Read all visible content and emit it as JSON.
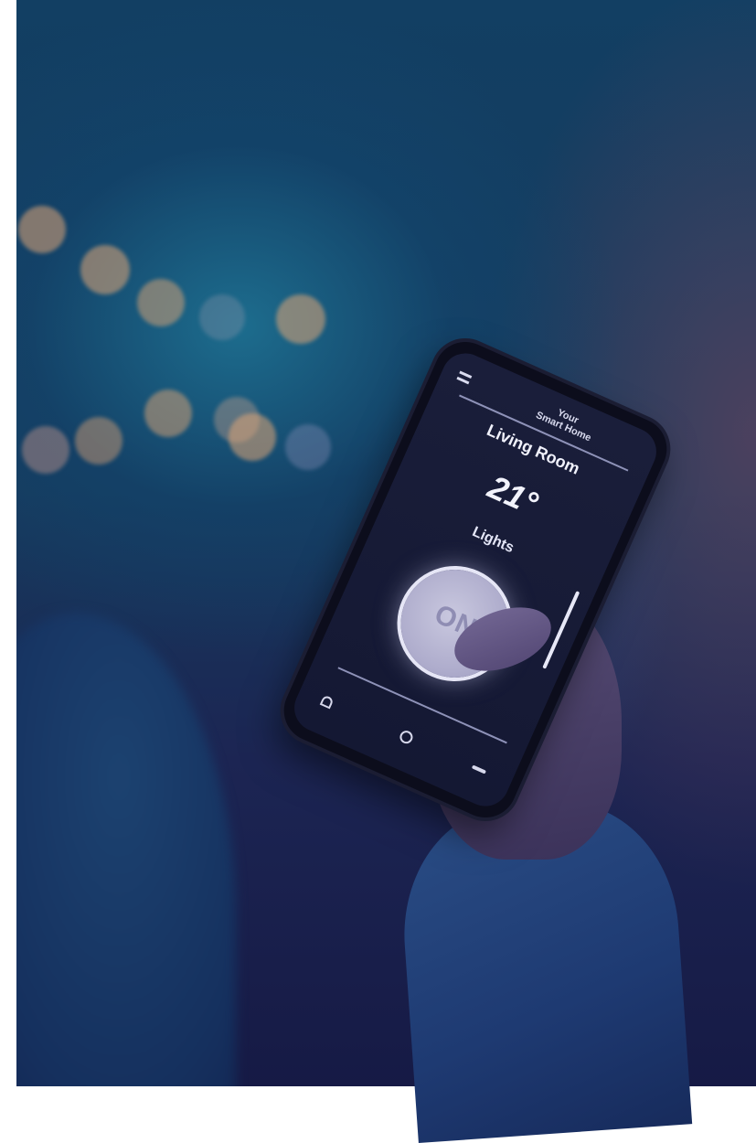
{
  "app": {
    "title": "Your\nSmart Home",
    "room": "Living Room",
    "temperature": "21°",
    "lights_label": "Lights",
    "power_button_label": "ON"
  },
  "nav": {
    "icons": [
      "home-icon",
      "circle-icon",
      "back-icon"
    ]
  },
  "colors": {
    "background_blue": "#123f63",
    "background_navy": "#161a45",
    "bokeh_orange": "#e0a576",
    "screen_bg": "#1a1e3a",
    "button_glow": "#e6e6f6"
  }
}
